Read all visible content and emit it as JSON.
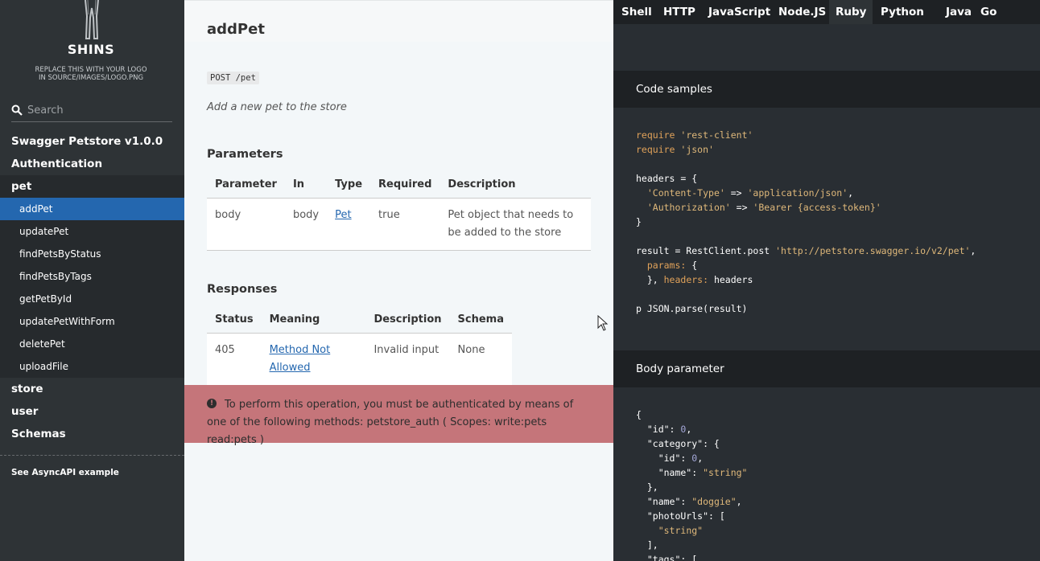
{
  "sidebar": {
    "logo_title": "SHINS",
    "logo_subtitle": "REPLACE THIS WITH YOUR LOGO\nIN SOURCE/IMAGES/LOGO.PNG",
    "search_placeholder": "Search",
    "items": [
      {
        "label": "Swagger Petstore v1.0.0"
      },
      {
        "label": "Authentication"
      },
      {
        "label": "pet"
      }
    ],
    "pet_subitems": [
      {
        "label": "addPet",
        "active": true
      },
      {
        "label": "updatePet"
      },
      {
        "label": "findPetsByStatus"
      },
      {
        "label": "findPetsByTags"
      },
      {
        "label": "getPetById"
      },
      {
        "label": "updatePetWithForm"
      },
      {
        "label": "deletePet"
      },
      {
        "label": "uploadFile"
      }
    ],
    "items_after": [
      {
        "label": "store"
      },
      {
        "label": "user"
      },
      {
        "label": "Schemas"
      }
    ],
    "asyncapi_link": "See AsyncAPI example"
  },
  "main": {
    "title": "addPet",
    "endpoint": "POST /pet",
    "description": "Add a new pet to the store",
    "parameters_heading": "Parameters",
    "parameters_table": {
      "headers": [
        "Parameter",
        "In",
        "Type",
        "Required",
        "Description"
      ],
      "rows": [
        {
          "parameter": "body",
          "in": "body",
          "type": "Pet",
          "required": "true",
          "description": "Pet object that needs to be added to the store"
        }
      ]
    },
    "responses_heading": "Responses",
    "responses_table": {
      "headers": [
        "Status",
        "Meaning",
        "Description",
        "Schema"
      ],
      "rows": [
        {
          "status": "405",
          "meaning": "Method Not Allowed",
          "description": "Invalid input",
          "schema": "None"
        }
      ]
    },
    "auth_icon": "!",
    "auth_notice": "To perform this operation, you must be authenticated by means of one of the following methods: petstore_auth ( Scopes: write:pets read:pets )"
  },
  "codepanel": {
    "languages": [
      "Shell",
      "HTTP",
      "JavaScript",
      "Node.JS",
      "Ruby",
      "Python",
      "Java",
      "Go"
    ],
    "active_language": "Ruby",
    "code_samples_title": "Code samples",
    "body_parameter_title": "Body parameter",
    "code_sample_lines": [
      "require 'rest-client'",
      "require 'json'",
      "",
      "headers = {",
      "  'Content-Type' => 'application/json',",
      "  'Authorization' => 'Bearer {access-token}'",
      "}",
      "",
      "result = RestClient.post 'http://petstore.swagger.io/v2/pet',",
      "  params: {",
      "  }, headers: headers",
      "",
      "p JSON.parse(result)"
    ],
    "body_parameter_lines": [
      "{",
      "  \"id\": 0,",
      "  \"category\": {",
      "    \"id\": 0,",
      "    \"name\": \"string\"",
      "  },",
      "  \"name\": \"doggie\",",
      "  \"photoUrls\": [",
      "    \"string\"",
      "  ],",
      "  \"tags\": ["
    ]
  },
  "colors": {
    "sidebar_bg": "#2e3336",
    "active_item": "#2467af",
    "auth_notice_bg": "#c5757a",
    "code_bg": "#292e33"
  }
}
